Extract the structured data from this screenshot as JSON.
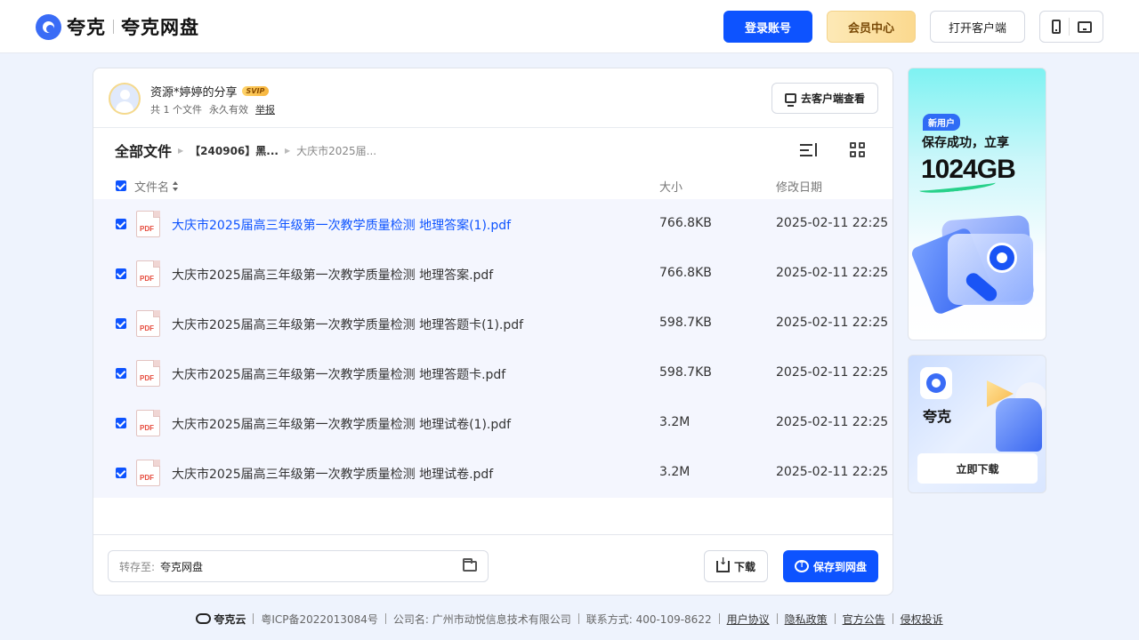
{
  "header": {
    "logo_brand": "夸克",
    "logo_product": "夸克网盘",
    "login_label": "登录账号",
    "vip_label": "会员中心",
    "client_label": "打开客户端"
  },
  "share": {
    "title": "资源*婷婷的分享",
    "badge": "SVIP",
    "file_count": "共 1 个文件",
    "validity": "永久有效",
    "report": "举报",
    "to_client_label": "去客户端查看"
  },
  "breadcrumb": {
    "root": "全部文件",
    "mid": "【240906】黑...",
    "last": "大庆市2025届..."
  },
  "table": {
    "columns": {
      "name": "文件名",
      "size": "大小",
      "date": "修改日期"
    },
    "rows": [
      {
        "name": "大庆市2025届高三年级第一次教学质量检测 地理答案(1).pdf",
        "size": "766.8KB",
        "date": "2025-02-11 22:25",
        "icon": "PDF"
      },
      {
        "name": "大庆市2025届高三年级第一次教学质量检测 地理答案.pdf",
        "size": "766.8KB",
        "date": "2025-02-11 22:25",
        "icon": "PDF"
      },
      {
        "name": "大庆市2025届高三年级第一次教学质量检测 地理答题卡(1).pdf",
        "size": "598.7KB",
        "date": "2025-02-11 22:25",
        "icon": "PDF"
      },
      {
        "name": "大庆市2025届高三年级第一次教学质量检测 地理答题卡.pdf",
        "size": "598.7KB",
        "date": "2025-02-11 22:25",
        "icon": "PDF"
      },
      {
        "name": "大庆市2025届高三年级第一次教学质量检测 地理试卷(1).pdf",
        "size": "3.2M",
        "date": "2025-02-11 22:25",
        "icon": "PDF"
      },
      {
        "name": "大庆市2025届高三年级第一次教学质量检测 地理试卷.pdf",
        "size": "3.2M",
        "date": "2025-02-11 22:25",
        "icon": "PDF"
      }
    ]
  },
  "actions": {
    "save_to_label": "转存至:",
    "save_to_value": "夸克网盘",
    "download_label": "下载",
    "save_label": "保存到网盘"
  },
  "ads": {
    "ad1_tag": "新用户",
    "ad1_line": "保存成功，立享",
    "ad1_big": "1024GB",
    "ad2_name": "夸克",
    "ad2_button": "立即下载"
  },
  "footer": {
    "brand": "夸克云",
    "icp": "粤ICP备2022013084号",
    "company": "公司名: 广州市动悦信息技术有限公司",
    "contact": "联系方式: 400-109-8622",
    "links": [
      "用户协议",
      "隐私政策",
      "官方公告",
      "侵权投诉"
    ]
  },
  "colors": {
    "accent": "#0d53ff",
    "background": "#eef3fd",
    "row_bg": "#f4f6fe",
    "pdf": "#e64b3c"
  }
}
